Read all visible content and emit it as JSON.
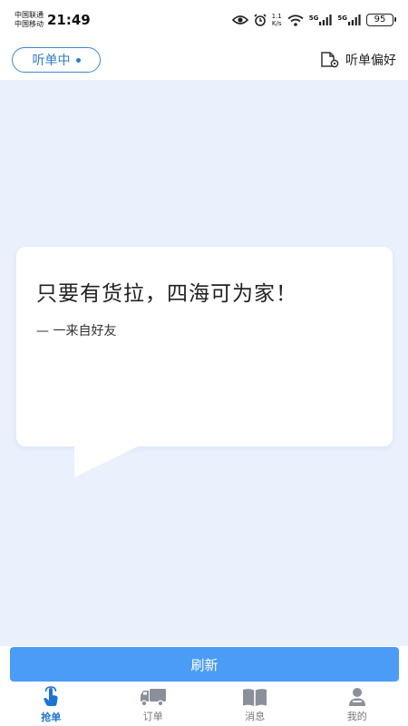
{
  "status_bar": {
    "carrier1": "中国联通",
    "carrier2": "中国移动",
    "time": "21:49",
    "net_speed_top": "1.1",
    "net_speed_bottom": "K/s",
    "sig1_label": "5G",
    "sig2_label": "5G",
    "battery": "95"
  },
  "header": {
    "listen_label": "听单中",
    "prefs_label": "听单偏好"
  },
  "quote": {
    "text": "只要有货拉，四海可为家！",
    "source": "— 一来自好友"
  },
  "refresh_label": "刷新",
  "nav": {
    "items": [
      {
        "label": "抢单",
        "icon": "hand-tap-icon",
        "active": true
      },
      {
        "label": "订单",
        "icon": "truck-icon",
        "active": false
      },
      {
        "label": "消息",
        "icon": "book-icon",
        "active": false
      },
      {
        "label": "我的",
        "icon": "person-icon",
        "active": false
      }
    ]
  },
  "colors": {
    "accent": "#4a9cf7",
    "active_nav": "#1a73d9",
    "background": "#eaf0fc",
    "inactive_nav": "#8a8f99"
  }
}
